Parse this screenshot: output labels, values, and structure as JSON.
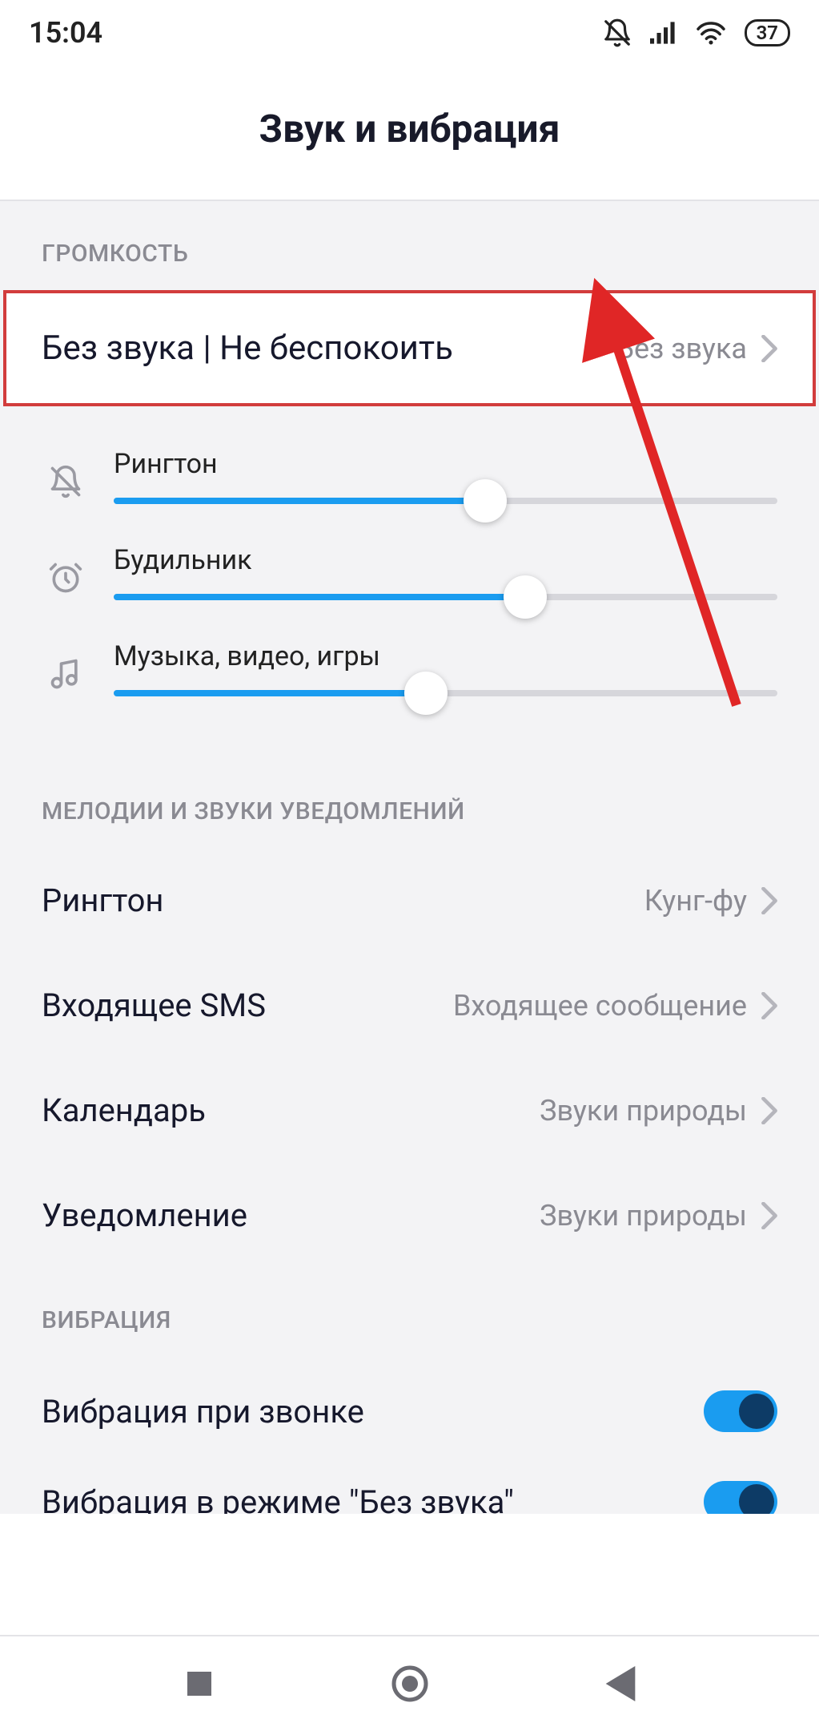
{
  "status": {
    "time": "15:04",
    "battery": "37"
  },
  "title": "Звук и вибрация",
  "sections": {
    "volume_label": "ГРОМКОСТЬ",
    "melodies_label": "МЕЛОДИИ И ЗВУКИ УВЕДОМЛЕНИЙ",
    "vibration_label": "ВИБРАЦИЯ"
  },
  "dnd": {
    "title": "Без звука | Не беспокоить",
    "value": "Без звука"
  },
  "sliders": {
    "ringtone": {
      "label": "Рингтон",
      "value": 56
    },
    "alarm": {
      "label": "Будильник",
      "value": 62
    },
    "media": {
      "label": "Музыка, видео, игры",
      "value": 47
    }
  },
  "rows": {
    "ringtone": {
      "title": "Рингтон",
      "value": "Кунг-фу"
    },
    "sms": {
      "title": "Входящее SMS",
      "value": "Входящее сообщение"
    },
    "calendar": {
      "title": "Календарь",
      "value": "Звуки природы"
    },
    "notification": {
      "title": "Уведомление",
      "value": "Звуки природы"
    }
  },
  "vibration": {
    "call": "Вибрация при звонке"
  },
  "partial": {
    "title": "Вибрация в режиме \"Без звука\""
  }
}
